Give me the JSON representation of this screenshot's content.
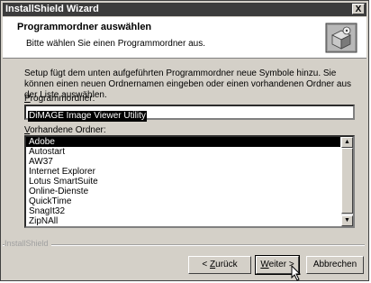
{
  "window": {
    "title": "InstallShield Wizard",
    "close_glyph": "X"
  },
  "header": {
    "title": "Programmordner auswählen",
    "subtitle": "Bitte wählen Sie einen Programmordner aus.",
    "icon": "installer-box-icon"
  },
  "description": "Setup fügt dem unten aufgeführten Programmordner neue Symbole hinzu. Sie können einen neuen Ordnernamen eingeben oder einen vorhandenen Ordner aus der Liste auswählen.",
  "program_folder": {
    "label_accel": "P",
    "label_rest": "rogrammordner:",
    "value": "DiMAGE Image Viewer Utility"
  },
  "existing_folders": {
    "label_accel": "V",
    "label_rest": "orhandene Ordner:",
    "items": [
      "Adobe",
      "Autostart",
      "AW37",
      "Internet Explorer",
      "Lotus SmartSuite",
      "Online-Dienste",
      "QuickTime",
      "SnagIt32",
      "ZipNAll"
    ],
    "selected_index": 0
  },
  "footer": {
    "brand": "InstallShield"
  },
  "buttons": {
    "back_prefix": "< ",
    "back_accel": "Z",
    "back_rest": "urück",
    "next_accel": "W",
    "next_rest": "eiter >",
    "cancel": "Abbrechen"
  },
  "colors": {
    "titlebar": "#3c3c3c",
    "dialog": "#d4d0c8",
    "selection": "#000000"
  }
}
